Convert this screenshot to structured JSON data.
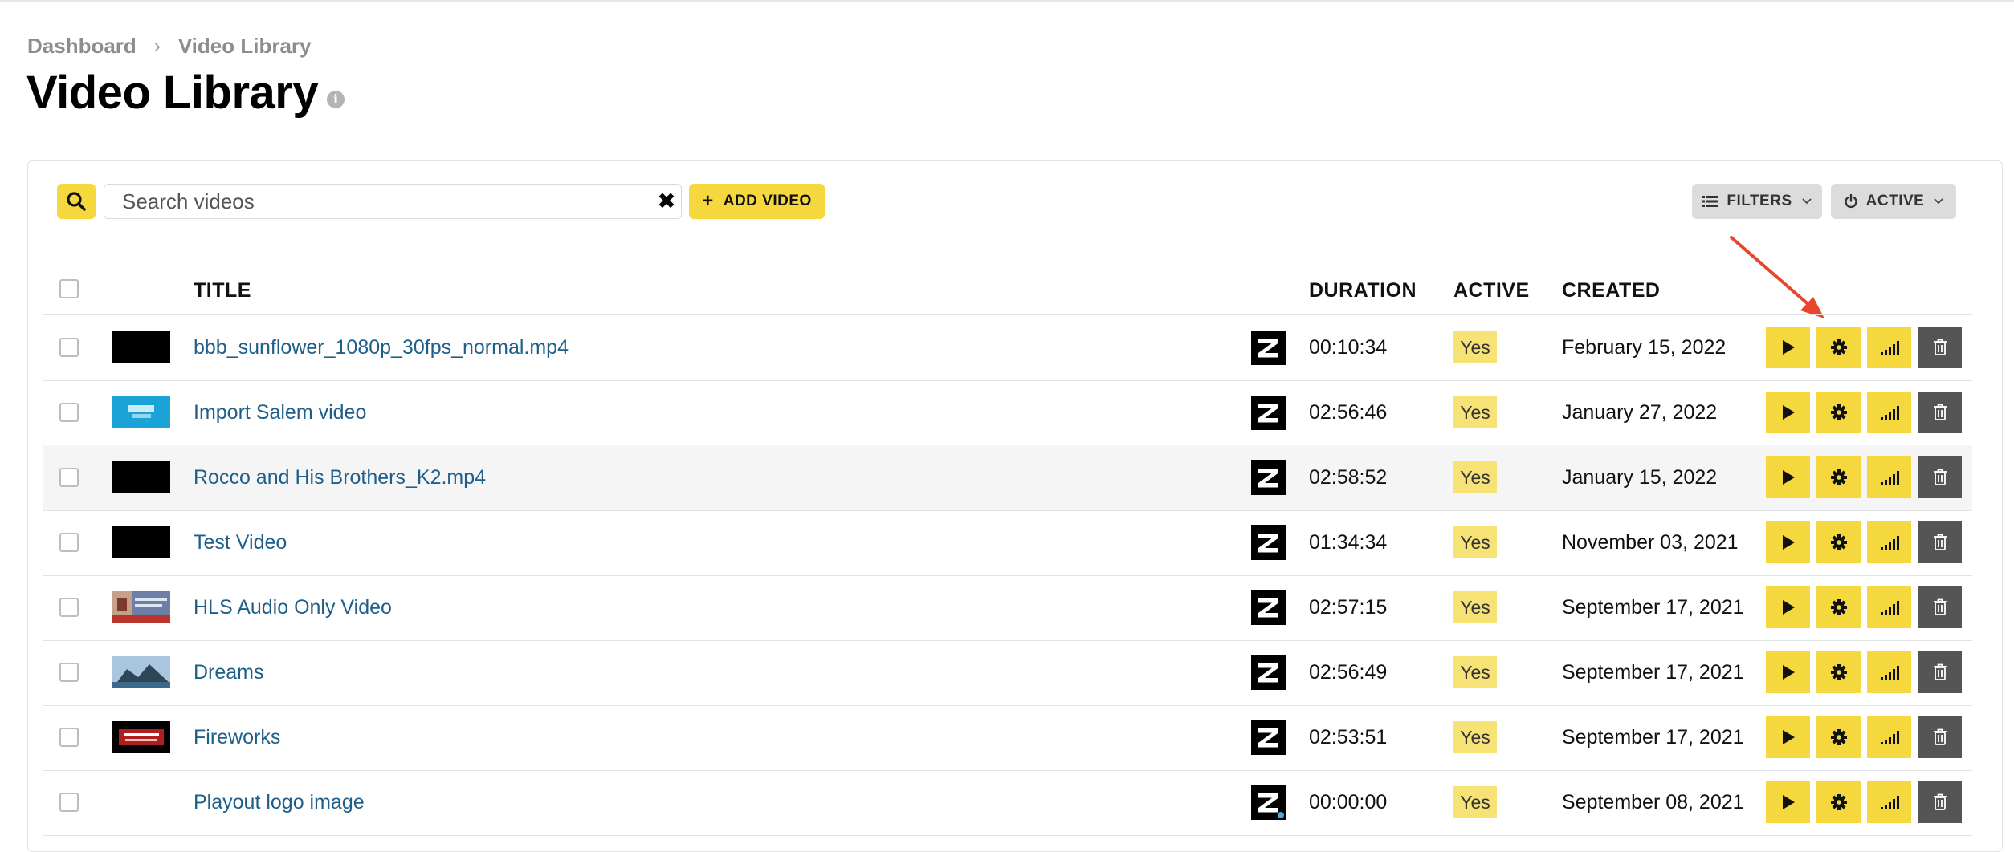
{
  "breadcrumb": {
    "items": [
      "Dashboard",
      "Video Library"
    ],
    "separator": "›"
  },
  "page": {
    "title": "Video Library",
    "info_icon": "info-icon"
  },
  "toolbar": {
    "search_placeholder": "Search videos",
    "search_value": "",
    "clear_label": "✖",
    "add_video_label": "ADD VIDEO",
    "filters_label": "FILTERS",
    "active_label": "ACTIVE"
  },
  "table": {
    "columns": {
      "title": "TITLE",
      "duration": "DURATION",
      "active": "ACTIVE",
      "created": "CREATED"
    },
    "rows": [
      {
        "title": "bbb_sunflower_1080p_30fps_normal.mp4",
        "duration": "00:10:34",
        "active": "Yes",
        "created": "February 15, 2022",
        "thumb": "black"
      },
      {
        "title": "Import Salem video",
        "duration": "02:56:46",
        "active": "Yes",
        "created": "January 27, 2022",
        "thumb": "blue"
      },
      {
        "title": "Rocco and His Brothers_K2.mp4",
        "duration": "02:58:52",
        "active": "Yes",
        "created": "January 15, 2022",
        "thumb": "black"
      },
      {
        "title": "Test Video",
        "duration": "01:34:34",
        "active": "Yes",
        "created": "November 03, 2021",
        "thumb": "black"
      },
      {
        "title": "HLS Audio Only Video",
        "duration": "02:57:15",
        "active": "Yes",
        "created": "September 17, 2021",
        "thumb": "news"
      },
      {
        "title": "Dreams",
        "duration": "02:56:49",
        "active": "Yes",
        "created": "September 17, 2021",
        "thumb": "landscape"
      },
      {
        "title": "Fireworks",
        "duration": "02:53:51",
        "active": "Yes",
        "created": "September 17, 2021",
        "thumb": "red-text"
      },
      {
        "title": "Playout logo image",
        "duration": "00:00:00",
        "active": "Yes",
        "created": "September 08, 2021",
        "thumb": "none"
      }
    ]
  },
  "colors": {
    "accent": "#f5d83d",
    "link": "#1e5f8a",
    "badge": "#f7e276",
    "delete": "#555555",
    "arrow": "#e8462c"
  }
}
